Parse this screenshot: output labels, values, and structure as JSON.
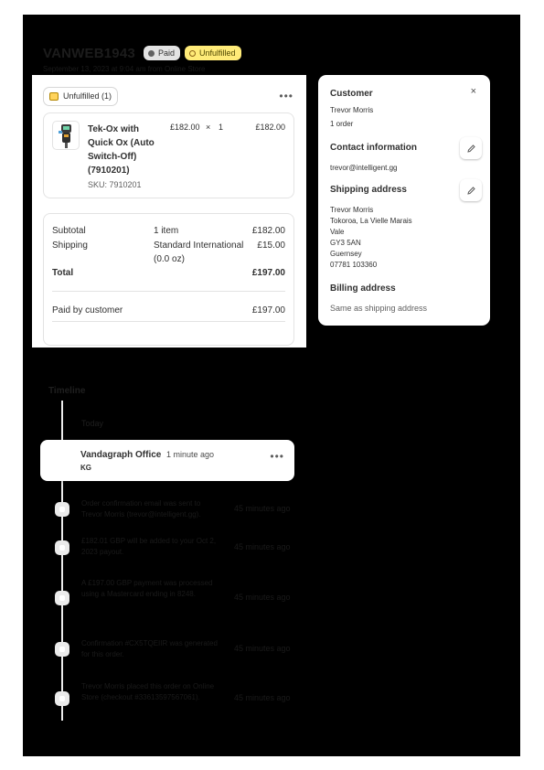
{
  "order": {
    "title": "VANWEB1943",
    "paid_badge": "Paid",
    "unfulfilled_badge": "Unfulfilled",
    "subline": "September 13, 2023 at 9:04 am from Online Store"
  },
  "fulfillment": {
    "chip_label": "Unfulfilled (1)",
    "more_label": "•••",
    "product": {
      "name": "Tek-Ox with Quick Ox (Auto Switch-Off) (7910201)",
      "sku": "SKU: 7910201",
      "price": "£182.00",
      "times": "×",
      "qty": "1",
      "total": "£182.00"
    }
  },
  "summary": {
    "subtotal_label": "Subtotal",
    "subtotal_detail": "1 item",
    "subtotal_value": "£182.00",
    "shipping_label": "Shipping",
    "shipping_detail_1": "Standard International",
    "shipping_detail_2": "(0.0 oz)",
    "shipping_value": "£15.00",
    "total_label": "Total",
    "total_value": "£197.00",
    "paid_label": "Paid by customer",
    "paid_value": "£197.00"
  },
  "customer": {
    "title": "Customer",
    "close": "×",
    "name": "Trevor Morris",
    "orders": "1 order",
    "contact_title": "Contact information",
    "email": "trevor@intelligent.gg",
    "shipping_title": "Shipping address",
    "address_lines": [
      "Trevor Morris",
      "Tokoroa, La Vielle Marais",
      "Vale",
      "GY3 5AN",
      "Guernsey",
      "07781 103360"
    ],
    "billing_title": "Billing address",
    "billing_text": "Same as shipping address"
  },
  "timeline": {
    "title": "Timeline",
    "today": "Today",
    "comment": {
      "author": "Vandagraph Office",
      "time": "1 minute ago",
      "text": "KG",
      "more": "•••"
    },
    "events": [
      {
        "text": "Order confirmation email was sent to Trevor Morris (trevor@intelligent.gg).",
        "time": "45 minutes ago"
      },
      {
        "text": "£182.01 GBP will be added to your Oct 2, 2023 payout.",
        "time": "45 minutes ago"
      },
      {
        "text": "A £197.00 GBP payment was processed using a Mastercard ending in 8248.",
        "time": "45 minutes ago"
      },
      {
        "text": "Confirmation #CX5TQEIIR was generated for this order.",
        "time": "45 minutes ago"
      },
      {
        "text": "Trevor Morris placed this order on Online Store (checkout #33613597567061).",
        "time": "45 minutes ago"
      }
    ]
  },
  "colors": {
    "background": "#000000",
    "card": "#ffffff",
    "paid_badge": "#e3e3e3",
    "unfulfilled_badge": "#ffeb78",
    "timeline_rail": "#ebebeb"
  }
}
